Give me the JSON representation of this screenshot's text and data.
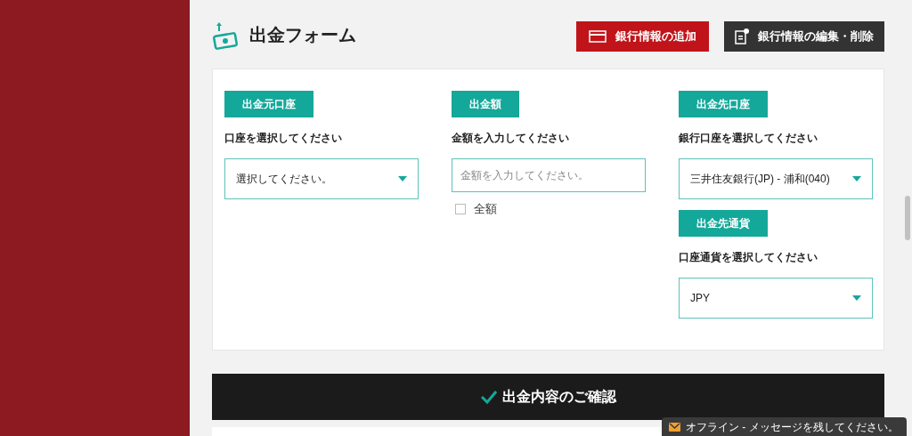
{
  "title": "出金フォーム",
  "buttons": [
    {
      "label": "銀行情報の追加",
      "kind": "add"
    },
    {
      "label": "銀行情報の編集・削除",
      "kind": "edit"
    }
  ],
  "columns": [
    [
      {
        "tag": "出金元口座",
        "instruction": "口座を選択してください",
        "field": {
          "kind": "select",
          "value": "選択してください。"
        }
      }
    ],
    [
      {
        "tag": "出金額",
        "instruction": "金額を入力してください",
        "field": {
          "kind": "input",
          "placeholder": "金額を入力してください。"
        },
        "checkbox": {
          "label": "全額",
          "checked": false
        }
      }
    ],
    [
      {
        "tag": "出金先口座",
        "instruction": "銀行口座を選択してください",
        "field": {
          "kind": "select",
          "value": "三井住友銀行(JP) - 浦和(040)"
        }
      },
      {
        "tag": "出金先通貨",
        "instruction": "口座通貨を選択してください",
        "field": {
          "kind": "select",
          "value": "JPY"
        }
      }
    ]
  ],
  "confirm_bar": {
    "title": "出金内容のご確認"
  },
  "chat_widget": {
    "text": "オフライン - メッセージを残してください。"
  }
}
